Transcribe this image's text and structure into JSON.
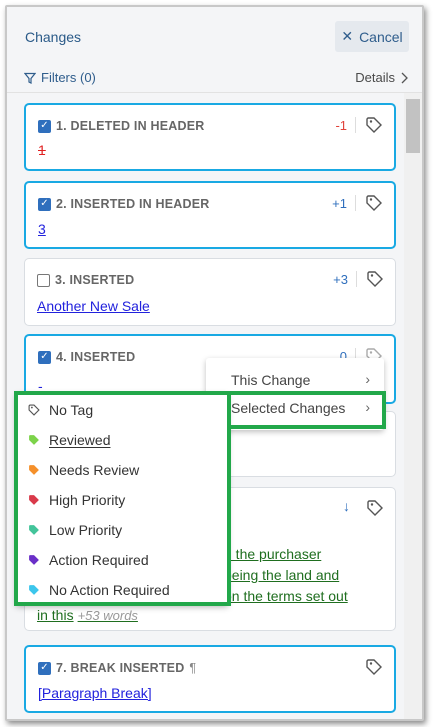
{
  "header": {
    "title": "Changes",
    "cancel_label": "Cancel"
  },
  "subbar": {
    "filters_label": "Filters (0)",
    "details_label": "Details"
  },
  "cards": [
    {
      "title": "1. DELETED IN HEADER",
      "count": "-1",
      "text": "1",
      "checked": true
    },
    {
      "title": "2. INSERTED IN HEADER",
      "count": "+1",
      "text": "3",
      "checked": true
    },
    {
      "title": "3. INSERTED",
      "count": "+3",
      "text": "Another New Sale ",
      "checked": false
    },
    {
      "title": "4. INSERTED",
      "count": "0",
      "text": "-",
      "checked": true
    },
    {
      "line1": "d the purchaser ",
      "line2": "being the land and",
      "line3": "on the terms set out",
      "line4": "in this",
      "more": "+53 words"
    },
    {
      "title": "7. BREAK INSERTED",
      "pilcrow": "¶",
      "text": "[Paragraph Break]",
      "checked": true
    }
  ],
  "submenu": {
    "this_change": "This Change",
    "selected_changes": "Selected Changes"
  },
  "tags": [
    {
      "label": "No Tag",
      "color": "#ffffff"
    },
    {
      "label": "Reviewed",
      "color": "#7cd34a",
      "underline_first": true
    },
    {
      "label": "Needs Review",
      "color": "#f5902a"
    },
    {
      "label": "High Priority",
      "color": "#d93a4a"
    },
    {
      "label": "Low Priority",
      "color": "#43c49a"
    },
    {
      "label": "Action Required",
      "color": "#6a2fc8"
    },
    {
      "label": "No Action Required",
      "color": "#3cc6ec"
    }
  ],
  "colors": {
    "accent": "#19a9e3",
    "highlight": "#22a84a"
  }
}
